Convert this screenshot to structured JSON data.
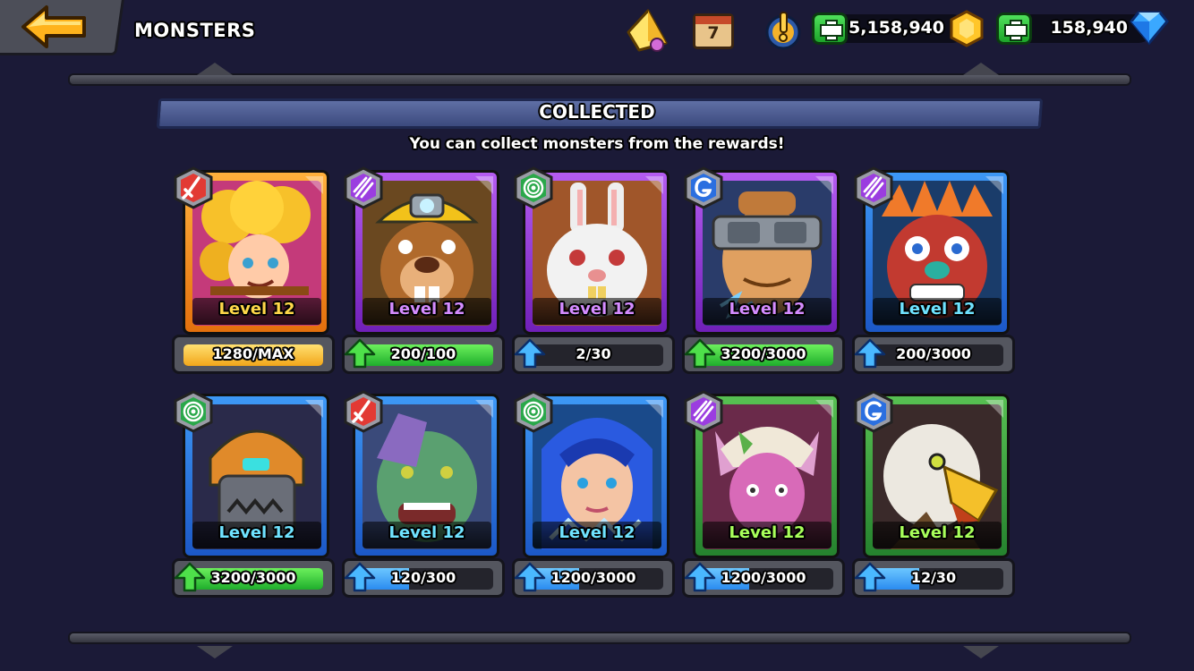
{
  "topbar": {
    "title": "MONSTERS",
    "icons": [
      "back-arrow-icon",
      "crystal-icon",
      "calendar-icon",
      "alert-icon"
    ],
    "calendar_day": "7",
    "gold_amount": "5,158,940",
    "gems_amount": "158,940"
  },
  "header": {
    "title": "COLLECTED",
    "subtitle": "You can collect monsters from the rewards!"
  },
  "colors": {
    "background": "#1b1a37",
    "orange": "#f08a1a",
    "purple": "#9a3ae0",
    "blue": "#2b7de0",
    "green": "#35a23a"
  },
  "monsters": [
    {
      "name_icon": "curly-haired-girl-portrait",
      "element": "sword",
      "rarity": "orange",
      "level": "Level 12",
      "progress": "1280/MAX",
      "fill": 1.0,
      "bar": "gold",
      "arrow": "none"
    },
    {
      "name_icon": "miner-beaver-portrait",
      "element": "slash",
      "rarity": "purple",
      "level": "Level 12",
      "progress": "200/100",
      "fill": 1.0,
      "bar": "green",
      "arrow": "green"
    },
    {
      "name_icon": "white-rabbit-portrait",
      "element": "target",
      "rarity": "purple",
      "level": "Level 12",
      "progress": "2/30",
      "fill": 0.07,
      "bar": "blue",
      "arrow": "blue"
    },
    {
      "name_icon": "goggles-warrior-portrait",
      "element": "g-rune",
      "rarity": "purple",
      "level": "Level 12",
      "progress": "3200/3000",
      "fill": 1.0,
      "bar": "green",
      "arrow": "green"
    },
    {
      "name_icon": "tribal-mask-portrait",
      "element": "slash",
      "rarity": "blue",
      "level": "Level 12",
      "progress": "200/3000",
      "fill": 0.07,
      "bar": "blue",
      "arrow": "blue"
    },
    {
      "name_icon": "robot-tiger-portrait",
      "element": "target",
      "rarity": "blue",
      "level": "Level 12",
      "progress": "3200/3000",
      "fill": 1.0,
      "bar": "green",
      "arrow": "green"
    },
    {
      "name_icon": "zombie-ogre-portrait",
      "element": "sword",
      "rarity": "blue",
      "level": "Level 12",
      "progress": "120/300",
      "fill": 0.4,
      "bar": "blue",
      "arrow": "blue"
    },
    {
      "name_icon": "ice-maiden-portrait",
      "element": "target",
      "rarity": "blue",
      "level": "Level 12",
      "progress": "1200/3000",
      "fill": 0.4,
      "bar": "blue",
      "arrow": "blue"
    },
    {
      "name_icon": "elf-girl-portrait",
      "element": "slash",
      "rarity": "green",
      "level": "Level 12",
      "progress": "1200/3000",
      "fill": 0.4,
      "bar": "blue",
      "arrow": "blue"
    },
    {
      "name_icon": "eagle-portrait",
      "element": "g-rune",
      "rarity": "green",
      "level": "Level 12",
      "progress": "12/30",
      "fill": 0.4,
      "bar": "blue",
      "arrow": "blue"
    }
  ]
}
